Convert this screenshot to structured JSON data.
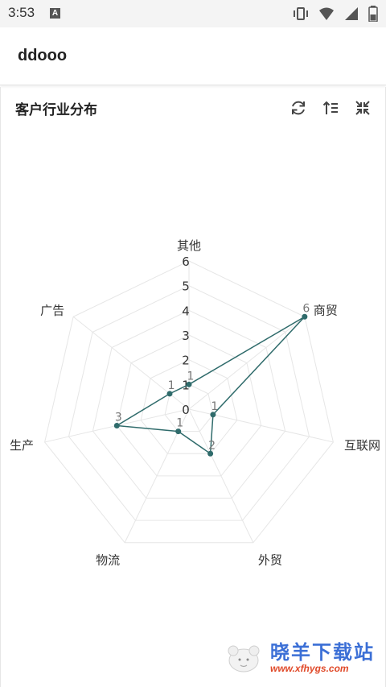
{
  "status_bar": {
    "time": "3:53",
    "notification_icon": "A"
  },
  "app_bar": {
    "title": "ddooo"
  },
  "card": {
    "title": "客户行业分布",
    "tools": [
      {
        "name": "refresh-icon"
      },
      {
        "name": "sort-icon"
      },
      {
        "name": "collapse-icon"
      }
    ]
  },
  "chart_data": {
    "type": "radar",
    "title": "客户行业分布",
    "indicators": [
      "其他",
      "商贸",
      "互联网",
      "外贸",
      "物流",
      "生产",
      "广告"
    ],
    "max": 6,
    "ticks": [
      "0",
      "1",
      "2",
      "3",
      "4",
      "5",
      "6"
    ],
    "series": [
      {
        "values": [
          1,
          6,
          1,
          2,
          1,
          3,
          1
        ]
      }
    ],
    "data_labels": [
      "1",
      "6",
      "1",
      "2",
      "1",
      "3",
      "1"
    ],
    "colors": {
      "line": "#2f6b6b",
      "point": "#2f6b6b",
      "grid": "#e6e6e6",
      "axis_text": "#333333",
      "tick_text": "#333333",
      "label_text": "#777777"
    }
  },
  "watermark": {
    "cn": "晓羊下载站",
    "en": "www.xfhygs.com"
  }
}
